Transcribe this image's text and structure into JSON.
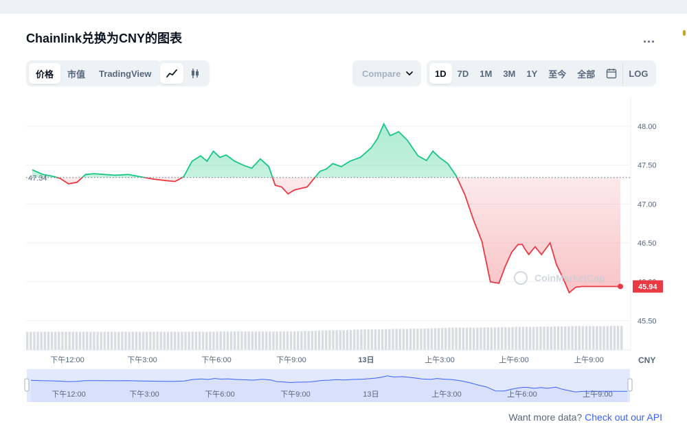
{
  "header": {
    "title": "Chainlink兑换为CNY的图表",
    "more_label": "..."
  },
  "toolbar": {
    "type_options": [
      "价格",
      "市值",
      "TradingView"
    ],
    "style_options": [
      "line-chart-icon",
      "candlestick-icon"
    ],
    "compare_placeholder": "Compare with",
    "range_options": [
      "1D",
      "7D",
      "1M",
      "3M",
      "1Y",
      "至今",
      "全部"
    ],
    "calendar_icon": "calendar-icon",
    "log_label": "LOG"
  },
  "chart_data": {
    "type": "line",
    "title": "",
    "currency_label": "CNY",
    "ylim": [
      45.3,
      48.3
    ],
    "yticks": [
      "48.00",
      "47.50",
      "47.00",
      "46.50",
      "46.00",
      "45.50"
    ],
    "xticks": [
      "下午12:00",
      "下午3:00",
      "下午6:00",
      "下午9:00",
      "13日",
      "上午3:00",
      "上午6:00",
      "上午9:00"
    ],
    "x": [
      "10:45",
      "11:10",
      "11:30",
      "11:50",
      "12:10",
      "12:30",
      "12:50",
      "13:10",
      "13:35",
      "14:00",
      "14:30",
      "15:00",
      "15:30",
      "16:00",
      "16:20",
      "16:40",
      "17:00",
      "17:20",
      "17:35",
      "17:50",
      "18:05",
      "18:20",
      "18:40",
      "19:00",
      "19:20",
      "19:40",
      "20:00",
      "20:15",
      "20:30",
      "20:45",
      "21:00",
      "21:30",
      "22:00",
      "22:15",
      "22:30",
      "22:50",
      "23:10",
      "23:35",
      "00:00",
      "00:15",
      "00:30",
      "00:45",
      "01:05",
      "01:25",
      "01:50",
      "02:10",
      "02:25",
      "02:40",
      "03:00",
      "03:20",
      "03:40",
      "04:00",
      "04:20",
      "04:40",
      "05:00",
      "05:15",
      "05:30",
      "05:45",
      "05:55",
      "06:00",
      "06:10",
      "06:25",
      "06:40",
      "07:00",
      "07:15",
      "07:30",
      "07:45",
      "08:00",
      "08:15",
      "08:35",
      "08:50",
      "09:05",
      "09:20",
      "09:35",
      "09:45"
    ],
    "series": [
      {
        "values": [
          47.44,
          47.38,
          47.36,
          47.33,
          47.26,
          47.28,
          47.38,
          47.39,
          47.38,
          47.37,
          47.38,
          47.35,
          47.32,
          47.3,
          47.29,
          47.35,
          47.55,
          47.62,
          47.55,
          47.68,
          47.6,
          47.63,
          47.55,
          47.5,
          47.46,
          47.58,
          47.48,
          47.24,
          47.22,
          47.13,
          47.18,
          47.22,
          47.42,
          47.45,
          47.52,
          47.48,
          47.55,
          47.6,
          47.72,
          47.84,
          48.03,
          47.88,
          47.93,
          47.82,
          47.62,
          47.56,
          47.68,
          47.6,
          47.52,
          47.36,
          47.12,
          46.8,
          46.52,
          46.0,
          45.98,
          46.2,
          46.38,
          46.48,
          46.48,
          46.43,
          46.35,
          46.45,
          46.35,
          46.5,
          46.22,
          46.05,
          45.86,
          45.93,
          45.94,
          45.94,
          45.94,
          45.94,
          45.94,
          45.94,
          45.94
        ]
      }
    ],
    "reference_price": 47.34,
    "reference_label": "47.34",
    "current_price": 45.94,
    "current_label": "45.94",
    "watermark": "CoinMarketCap",
    "volume": [
      0.52,
      0.52,
      0.52,
      0.52,
      0.52,
      0.52,
      0.52,
      0.52,
      0.52,
      0.52,
      0.52,
      0.52,
      0.52,
      0.52,
      0.52,
      0.52,
      0.52,
      0.52,
      0.52,
      0.52,
      0.52,
      0.52,
      0.52,
      0.52,
      0.53,
      0.53,
      0.53,
      0.53,
      0.53,
      0.53,
      0.53,
      0.53,
      0.53,
      0.53,
      0.54,
      0.55,
      0.56,
      0.57,
      0.58,
      0.58,
      0.59,
      0.6,
      0.61,
      0.61,
      0.61,
      0.62,
      0.63,
      0.63,
      0.64,
      0.64,
      0.65,
      0.66,
      0.67,
      0.68,
      0.68,
      0.68,
      0.68,
      0.69,
      0.69,
      0.7,
      0.7,
      0.71,
      0.71,
      0.71,
      0.72,
      0.72,
      0.73,
      0.73,
      0.74,
      0.74,
      0.74,
      0.74,
      0.74,
      0.75,
      0.75
    ],
    "navigator_ticks": [
      "下午12:00",
      "下午3:00",
      "下午6:00",
      "下午9:00",
      "13日",
      "上午3:00",
      "上午6:00",
      "上午9:00"
    ]
  },
  "colors": {
    "up": "#16c784",
    "down": "#ea3943",
    "navigator_fill": "#e3e9fd",
    "navigator_line": "#3861fb",
    "volume": "#d9dce1"
  },
  "footer": {
    "prompt": "Want more data?",
    "link": "Check out our API"
  }
}
